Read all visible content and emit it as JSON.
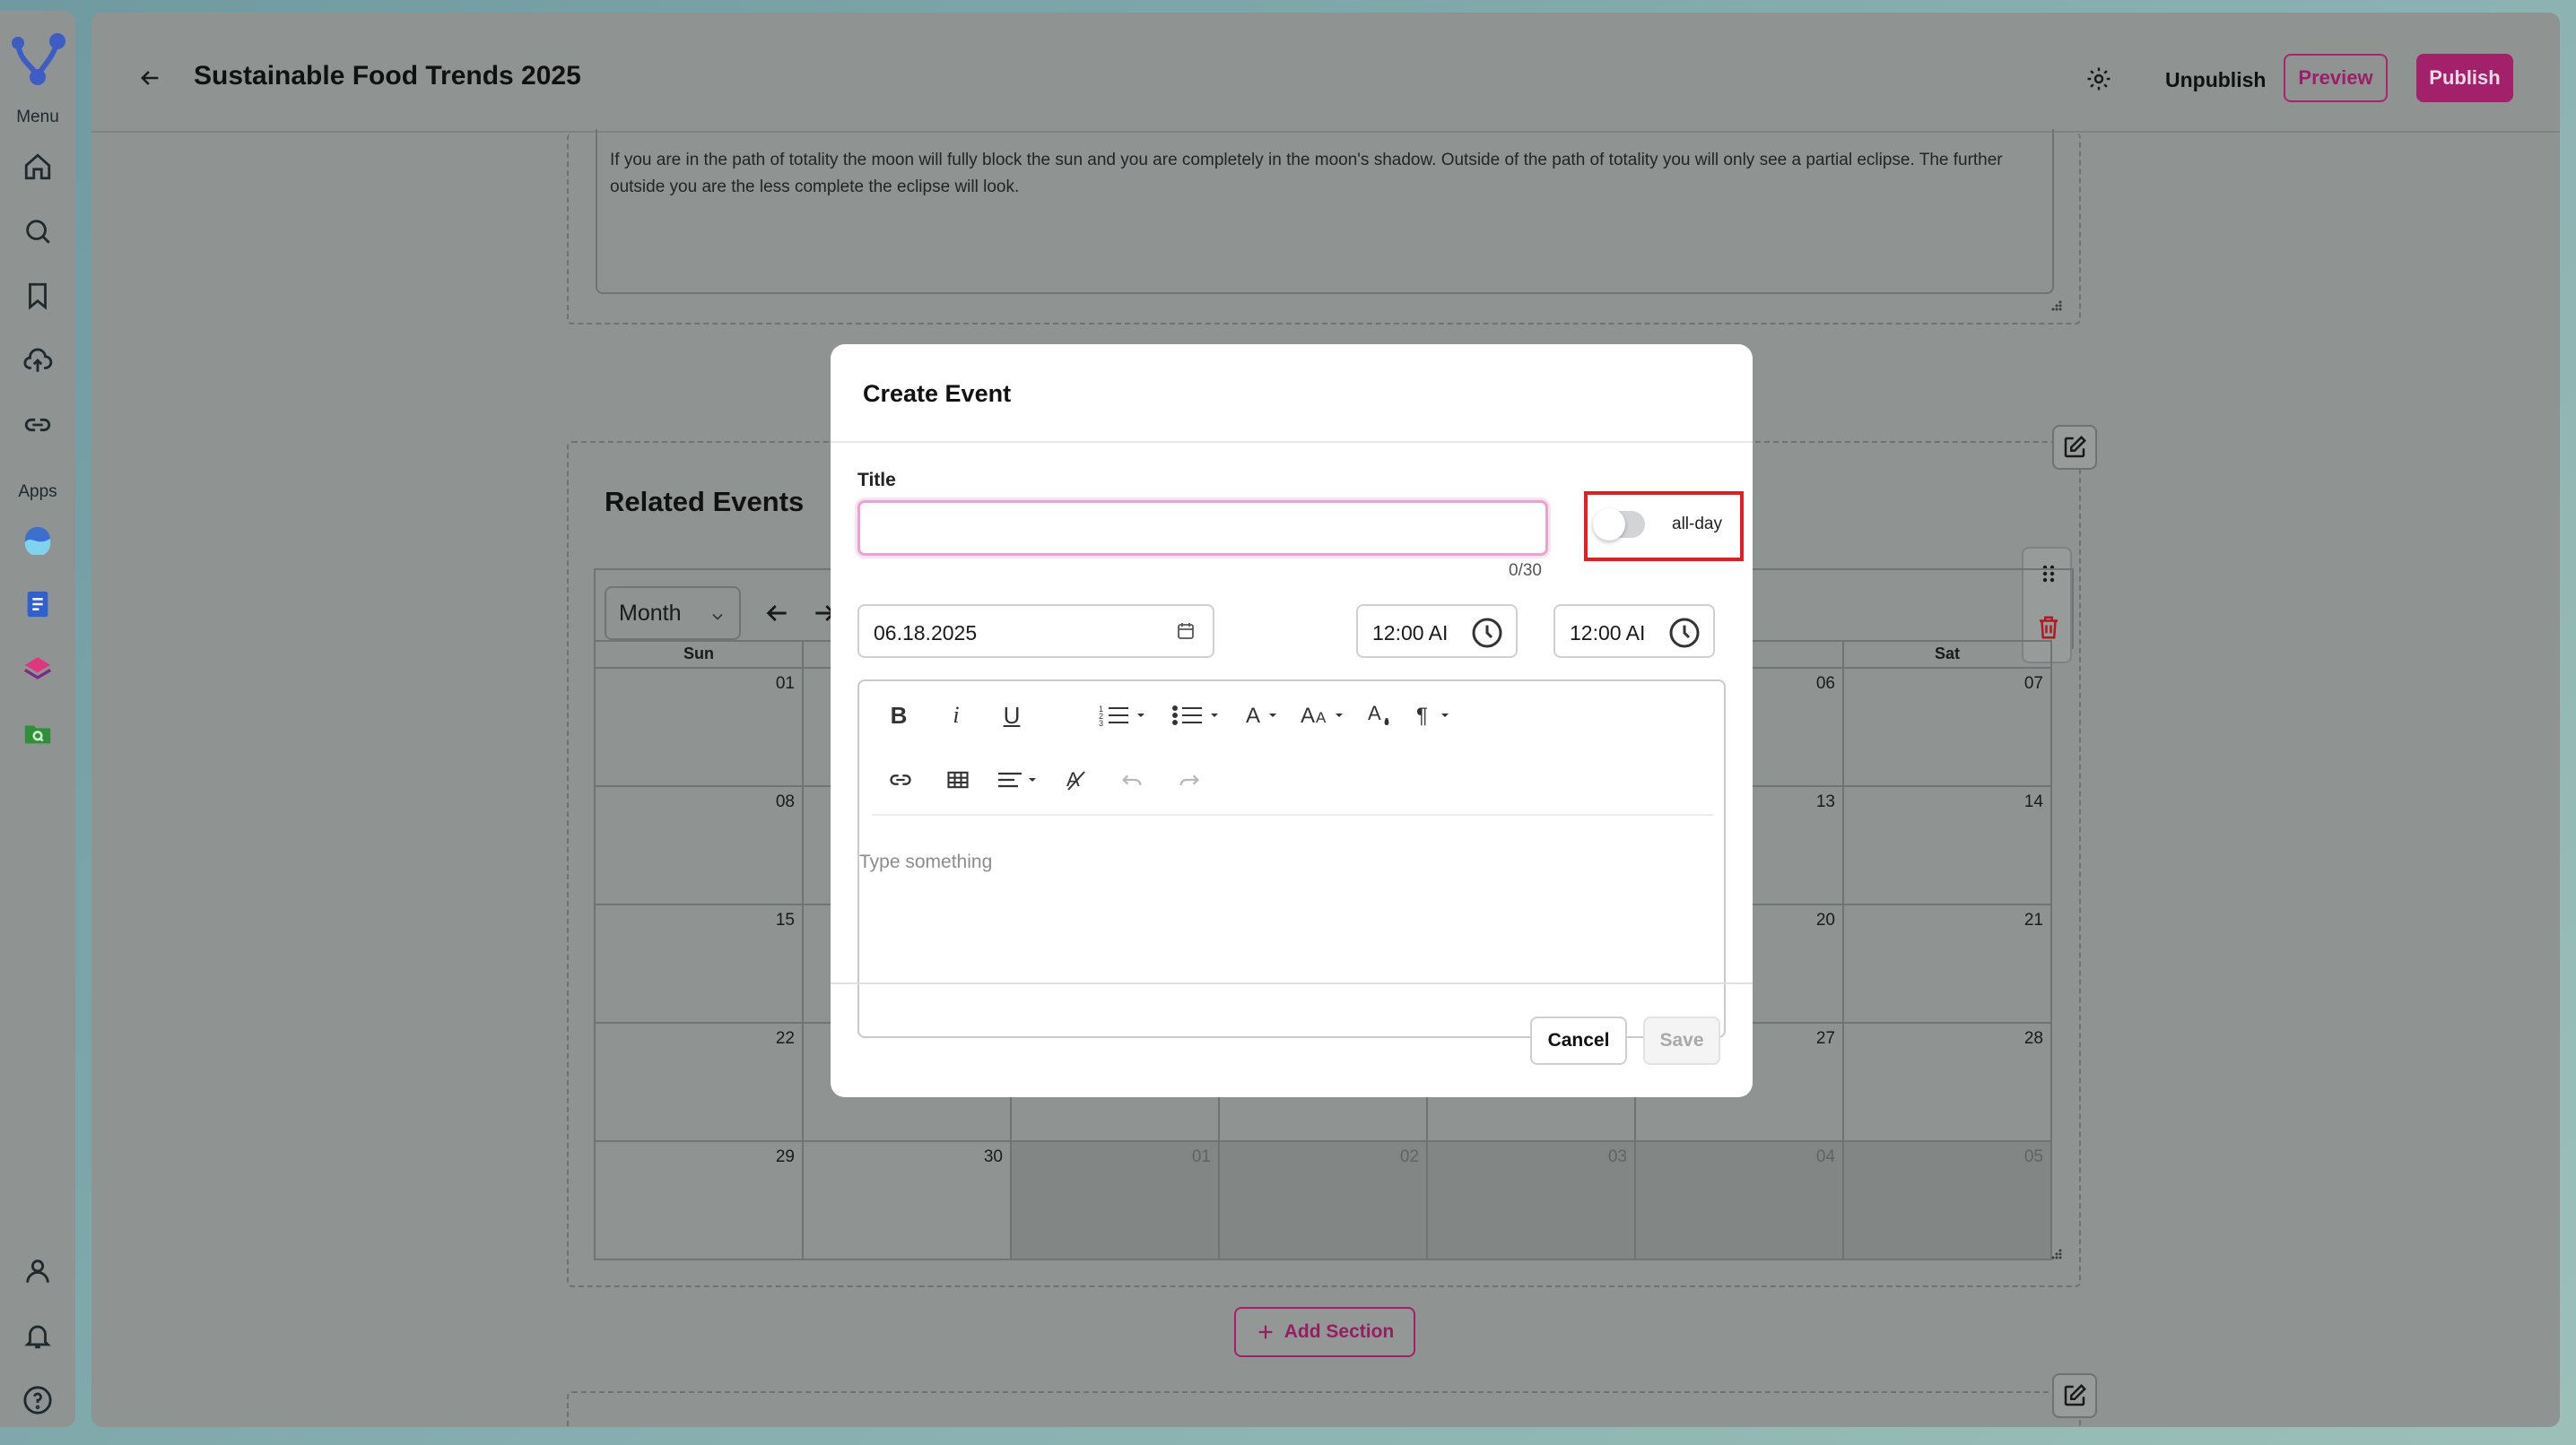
{
  "rail": {
    "menu_heading": "Menu",
    "apps_heading": "Apps",
    "menu_items": [
      "home-icon",
      "search-icon",
      "bookmark-icon",
      "upload-cloud-icon",
      "link-icon"
    ],
    "app_items": [
      "wave-app-icon",
      "document-app-icon",
      "layers-app-icon",
      "folder-search-app-icon"
    ],
    "bottom_items": [
      "user-icon",
      "bell-icon",
      "help-icon"
    ]
  },
  "header": {
    "title": "Sustainable Food Trends 2025",
    "unpublish_label": "Unpublish",
    "preview_label": "Preview",
    "publish_label": "Publish"
  },
  "text_section": {
    "body": "If you are in the path of totality the moon will fully block the sun and you are completely in the moon's shadow. Outside of the path of totality you will only see a partial eclipse. The further outside you are the less complete the eclipse will look."
  },
  "events_section": {
    "title": "Related Events",
    "view_select": "Month",
    "weekdays": [
      "Sun",
      "",
      "",
      "",
      "",
      "",
      "Sat"
    ],
    "weeks": [
      [
        {
          "d": "01"
        },
        {
          "d": ""
        },
        {
          "d": ""
        },
        {
          "d": ""
        },
        {
          "d": ""
        },
        {
          "d": "06"
        },
        {
          "d": "07"
        }
      ],
      [
        {
          "d": "08"
        },
        {
          "d": ""
        },
        {
          "d": ""
        },
        {
          "d": ""
        },
        {
          "d": ""
        },
        {
          "d": "13"
        },
        {
          "d": "14"
        }
      ],
      [
        {
          "d": "15"
        },
        {
          "d": ""
        },
        {
          "d": ""
        },
        {
          "d": ""
        },
        {
          "d": ""
        },
        {
          "d": "20"
        },
        {
          "d": "21"
        }
      ],
      [
        {
          "d": "22"
        },
        {
          "d": ""
        },
        {
          "d": ""
        },
        {
          "d": ""
        },
        {
          "d": ""
        },
        {
          "d": "27"
        },
        {
          "d": "28"
        }
      ],
      [
        {
          "d": "29"
        },
        {
          "d": "30"
        },
        {
          "d": "01",
          "other": true
        },
        {
          "d": "02",
          "other": true
        },
        {
          "d": "03",
          "other": true
        },
        {
          "d": "04",
          "other": true
        },
        {
          "d": "05",
          "other": true
        }
      ]
    ]
  },
  "add_section_label": "Add Section",
  "modal": {
    "title": "Create Event",
    "title_label": "Title",
    "title_value": "",
    "char_count": "0/30",
    "allday_label": "all-day",
    "allday_on": false,
    "date_value": "06.18.2025",
    "start_time": "12:00 AI",
    "end_time": "12:00 AI",
    "editor_placeholder": "Type something",
    "cancel_label": "Cancel",
    "save_label": "Save"
  },
  "colors": {
    "brand": "#a3206a",
    "highlight_box": "#e02020",
    "input_focus": "#e9a2d1"
  }
}
